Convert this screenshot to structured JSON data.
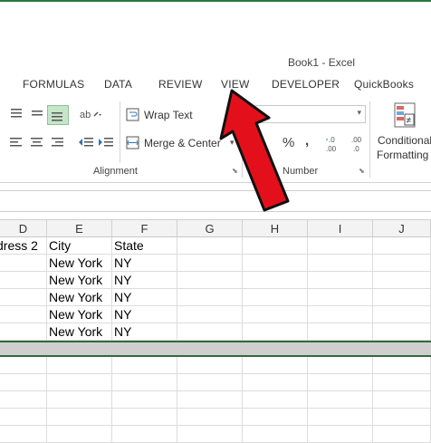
{
  "window": {
    "title": "Book1 - Excel"
  },
  "tabs": [
    "FORMULAS",
    "DATA",
    "REVIEW",
    "VIEW",
    "DEVELOPER",
    "QuickBooks"
  ],
  "ribbon": {
    "wrap_text": "Wrap Text",
    "merge_center": "Merge & Center",
    "alignment_label": "Alignment",
    "number_label": "Number",
    "percent": "%",
    "comma": ",",
    "conditional_line1": "Conditional",
    "conditional_line2": "Formatting"
  },
  "sheet": {
    "columns": [
      "D",
      "E",
      "F",
      "G",
      "H",
      "I",
      "J"
    ],
    "rows": [
      [
        "dress 2",
        "City",
        "State",
        "",
        "",
        "",
        ""
      ],
      [
        "",
        "New York",
        "NY",
        "",
        "",
        "",
        ""
      ],
      [
        "",
        "New York",
        "NY",
        "",
        "",
        "",
        ""
      ],
      [
        "",
        "New York",
        "NY",
        "",
        "",
        "",
        ""
      ],
      [
        "",
        "New York",
        "NY",
        "",
        "",
        "",
        ""
      ],
      [
        "",
        "New York",
        "NY",
        "",
        "",
        "",
        ""
      ]
    ]
  },
  "colors": {
    "accent_green": "#2e6b3f",
    "arrow_red": "#e3101c"
  }
}
